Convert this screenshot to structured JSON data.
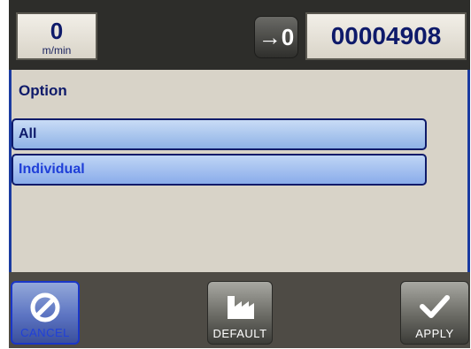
{
  "header": {
    "speed_value": "0",
    "speed_unit": "m/min",
    "reset_icon_label": "→0",
    "counter": "00004908"
  },
  "content": {
    "title": "Option",
    "options": [
      {
        "label": "All"
      },
      {
        "label": "Individual"
      }
    ]
  },
  "footer": {
    "cancel_label": "CANCEL",
    "default_label": "DEFAULT",
    "apply_label": "APPLY"
  },
  "icons": {
    "cancel": "no-entry-icon",
    "default": "factory-icon",
    "apply": "checkmark-icon",
    "reset": "reset-counter-icon"
  },
  "colors": {
    "frame": "#0a1f8f",
    "panel": "#d8d3c8",
    "header": "#2d2d2a",
    "text_dark": "#0e1a6a",
    "selected_text": "#1f3fd8"
  }
}
